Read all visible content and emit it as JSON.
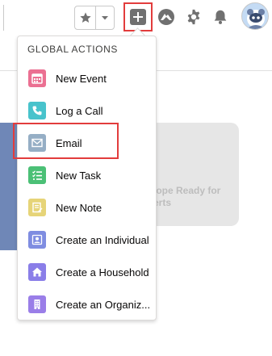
{
  "header": {
    "favorites_star_icon": "star-icon",
    "favorites_dropdown_icon": "chevron-down-icon",
    "global_actions_icon": "plus-icon",
    "trailhead_icon": "trailhead-icon",
    "setup_icon": "gear-icon",
    "notifications_icon": "bell-icon",
    "avatar_icon": "astro-avatar"
  },
  "background": {
    "card_text_line1": "lope Ready for",
    "card_text_line2": "erts"
  },
  "dropdown": {
    "title": "GLOBAL ACTIONS",
    "items": [
      {
        "label": "New Event",
        "icon": "calendar-icon",
        "color": "#eb7092"
      },
      {
        "label": "Log a Call",
        "icon": "phone-icon",
        "color": "#48c3cc"
      },
      {
        "label": "Email",
        "icon": "envelope-icon",
        "color": "#95aec5"
      },
      {
        "label": "New Task",
        "icon": "task-list-icon",
        "color": "#4bc076"
      },
      {
        "label": "New Note",
        "icon": "note-icon",
        "color": "#e6d478"
      },
      {
        "label": "Create an Individual",
        "icon": "contact-icon",
        "color": "#7f8de1"
      },
      {
        "label": "Create a Household",
        "icon": "household-icon",
        "color": "#8a7ee8"
      },
      {
        "label": "Create an Organiz...",
        "icon": "building-icon",
        "color": "#9a7ee8"
      }
    ]
  },
  "colors": {
    "highlight": "#e23c3c",
    "icon_gray": "#707070"
  }
}
